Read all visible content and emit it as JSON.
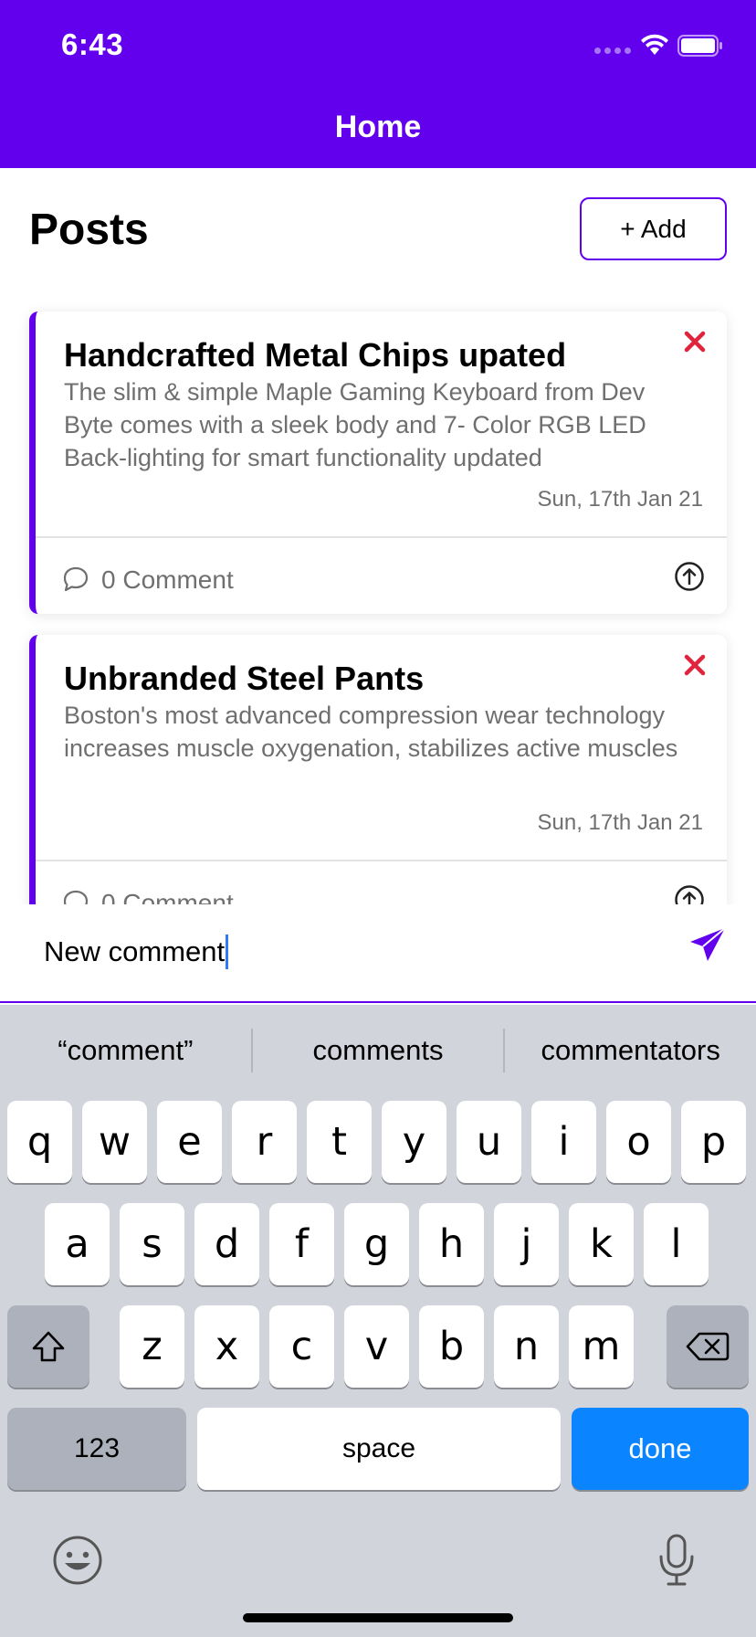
{
  "status_bar": {
    "time": "6:43"
  },
  "nav": {
    "title": "Home"
  },
  "posts": {
    "heading": "Posts",
    "add_label": "+ Add",
    "items": [
      {
        "title": "Handcrafted Metal Chips upated",
        "body": "The slim & simple Maple Gaming Keyboard from Dev Byte comes with a sleek body and 7- Color RGB LED Back-lighting for smart functionality updated",
        "date": "Sun, 17th Jan 21",
        "comments": "0 Comment"
      },
      {
        "title": "Unbranded Steel Pants",
        "body": "Boston's most advanced compression wear technology increases muscle oxygenation, stabilizes active muscles",
        "date": "Sun, 17th Jan 21",
        "comments": "0 Comment"
      }
    ]
  },
  "comment_bar": {
    "value": "New comment"
  },
  "keyboard": {
    "suggestions": [
      "“comment”",
      "comments",
      "commentators"
    ],
    "row1": [
      "q",
      "w",
      "e",
      "r",
      "t",
      "y",
      "u",
      "i",
      "o",
      "p"
    ],
    "row2": [
      "a",
      "s",
      "d",
      "f",
      "g",
      "h",
      "j",
      "k",
      "l"
    ],
    "row3": [
      "z",
      "x",
      "c",
      "v",
      "b",
      "n",
      "m"
    ],
    "numbers_label": "123",
    "space_label": "space",
    "done_label": "done"
  },
  "colors": {
    "accent": "#6200EE",
    "delete": "#E0243B",
    "done_key": "#0A84FF",
    "keyboard_bg": "#D2D4DB"
  },
  "icons": [
    "wifi-icon",
    "battery-icon",
    "close-icon",
    "comment-icon",
    "upload-icon",
    "send-icon",
    "shift-icon",
    "backspace-icon",
    "emoji-icon",
    "microphone-icon"
  ]
}
